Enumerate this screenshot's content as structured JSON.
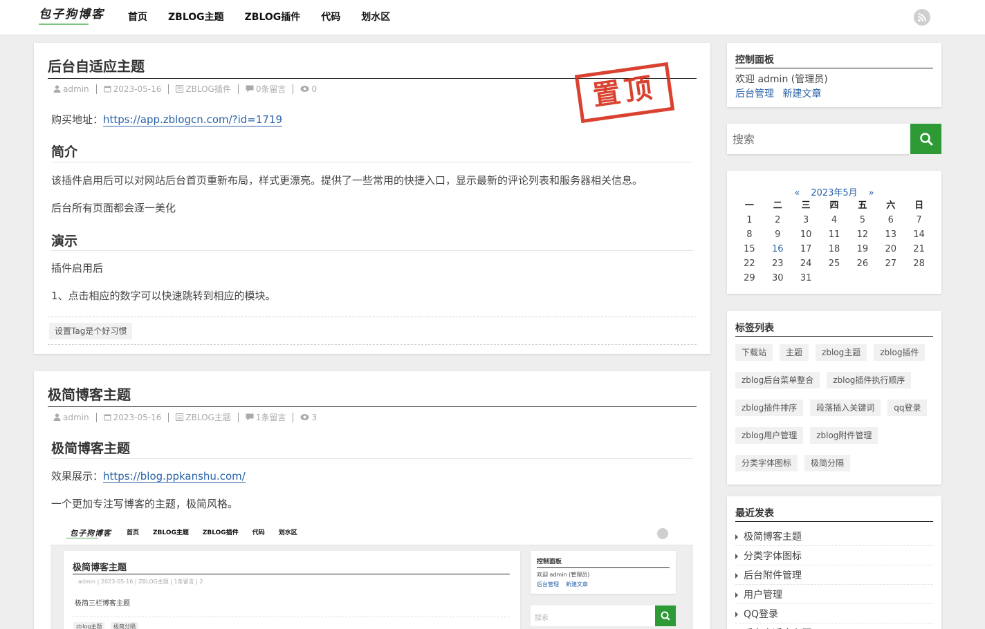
{
  "header": {
    "logo_text": "包子狗博客",
    "nav": [
      "首页",
      "ZBLOG主题",
      "ZBLOG插件",
      "代码",
      "划水区"
    ]
  },
  "post1": {
    "title": "后台自适应主题",
    "meta": {
      "author": "admin",
      "date": "2023-05-16",
      "category": "ZBLOG插件",
      "comments": "0条留言",
      "views": "0"
    },
    "stamp": "置顶",
    "buy_label": "购买地址：",
    "buy_url": "https://app.zblogcn.com/?id=1719",
    "h_intro": "简介",
    "p1": "该插件启用后可以对网站后台首页重新布局，样式更漂亮。提供了一些常用的快捷入口，显示最新的评论列表和服务器相关信息。",
    "p2": "后台所有页面都会逐一美化",
    "h_demo": "演示",
    "p3": "插件启用后",
    "p4": "1、点击相应的数字可以快速跳转到相应的模块。",
    "tag": "设置Tag是个好习惯"
  },
  "post2": {
    "title": "极简博客主题",
    "meta": {
      "author": "admin",
      "date": "2023-05-16",
      "category": "ZBLOG主题",
      "comments": "1条留言",
      "views": "3"
    },
    "h_title": "极简博客主题",
    "demo_label": "效果展示：",
    "demo_url": "https://blog.ppkanshu.com/",
    "p1": "一个更加专注写博客的主题，极简风格。"
  },
  "sidebar": {
    "panel": {
      "title": "控制面板",
      "welcome": "欢迎 admin (管理员)",
      "link1": "后台管理",
      "link2": "新建文章"
    },
    "search": {
      "placeholder": "搜索"
    },
    "calendar": {
      "prev": "«",
      "next": "»",
      "month": "2023年5月",
      "weekdays": [
        "一",
        "二",
        "三",
        "四",
        "五",
        "六",
        "日"
      ],
      "days": [
        "1",
        "2",
        "3",
        "4",
        "5",
        "6",
        "7",
        "8",
        "9",
        "10",
        "11",
        "12",
        "13",
        "14",
        "15",
        "16",
        "17",
        "18",
        "19",
        "20",
        "21",
        "22",
        "23",
        "24",
        "25",
        "26",
        "27",
        "28",
        "29",
        "30",
        "31"
      ],
      "linked_day": "16"
    },
    "tags": {
      "title": "标签列表",
      "items": [
        "下载站",
        "主题",
        "zblog主题",
        "zblog插件",
        "zblog后台菜单整合",
        "zblog插件执行顺序",
        "zblog插件排序",
        "段落插入关键词",
        "qq登录",
        "zblog用户管理",
        "zblog附件管理",
        "分类字体图标",
        "极简分隔"
      ]
    },
    "recent": {
      "title": "最近发表",
      "items": [
        "极简博客主题",
        "分类字体图标",
        "后台附件管理",
        "用户管理",
        "QQ登录",
        "后台自适应主题"
      ]
    }
  },
  "screenshot": {
    "logo_text": "包子狗博客",
    "nav": [
      "首页",
      "ZBLOG主题",
      "ZBLOG插件",
      "代码",
      "划水区"
    ],
    "post_title": "极简博客主题",
    "meta": "admin  |  2023-05-16  |  ZBLOG主题  |  1条留言  |  2",
    "body": "极简三栏博客主题",
    "tags": [
      "zblog主题",
      "极简分隔"
    ],
    "panel_title": "控制面板",
    "welcome": "欢迎 admin (管理员)",
    "link1": "后台管理",
    "link2": "新建文章",
    "search_placeholder": "搜索"
  },
  "colors": {
    "accent": "#2e9a36",
    "link": "#2962a8",
    "stamp": "#d6321f"
  }
}
